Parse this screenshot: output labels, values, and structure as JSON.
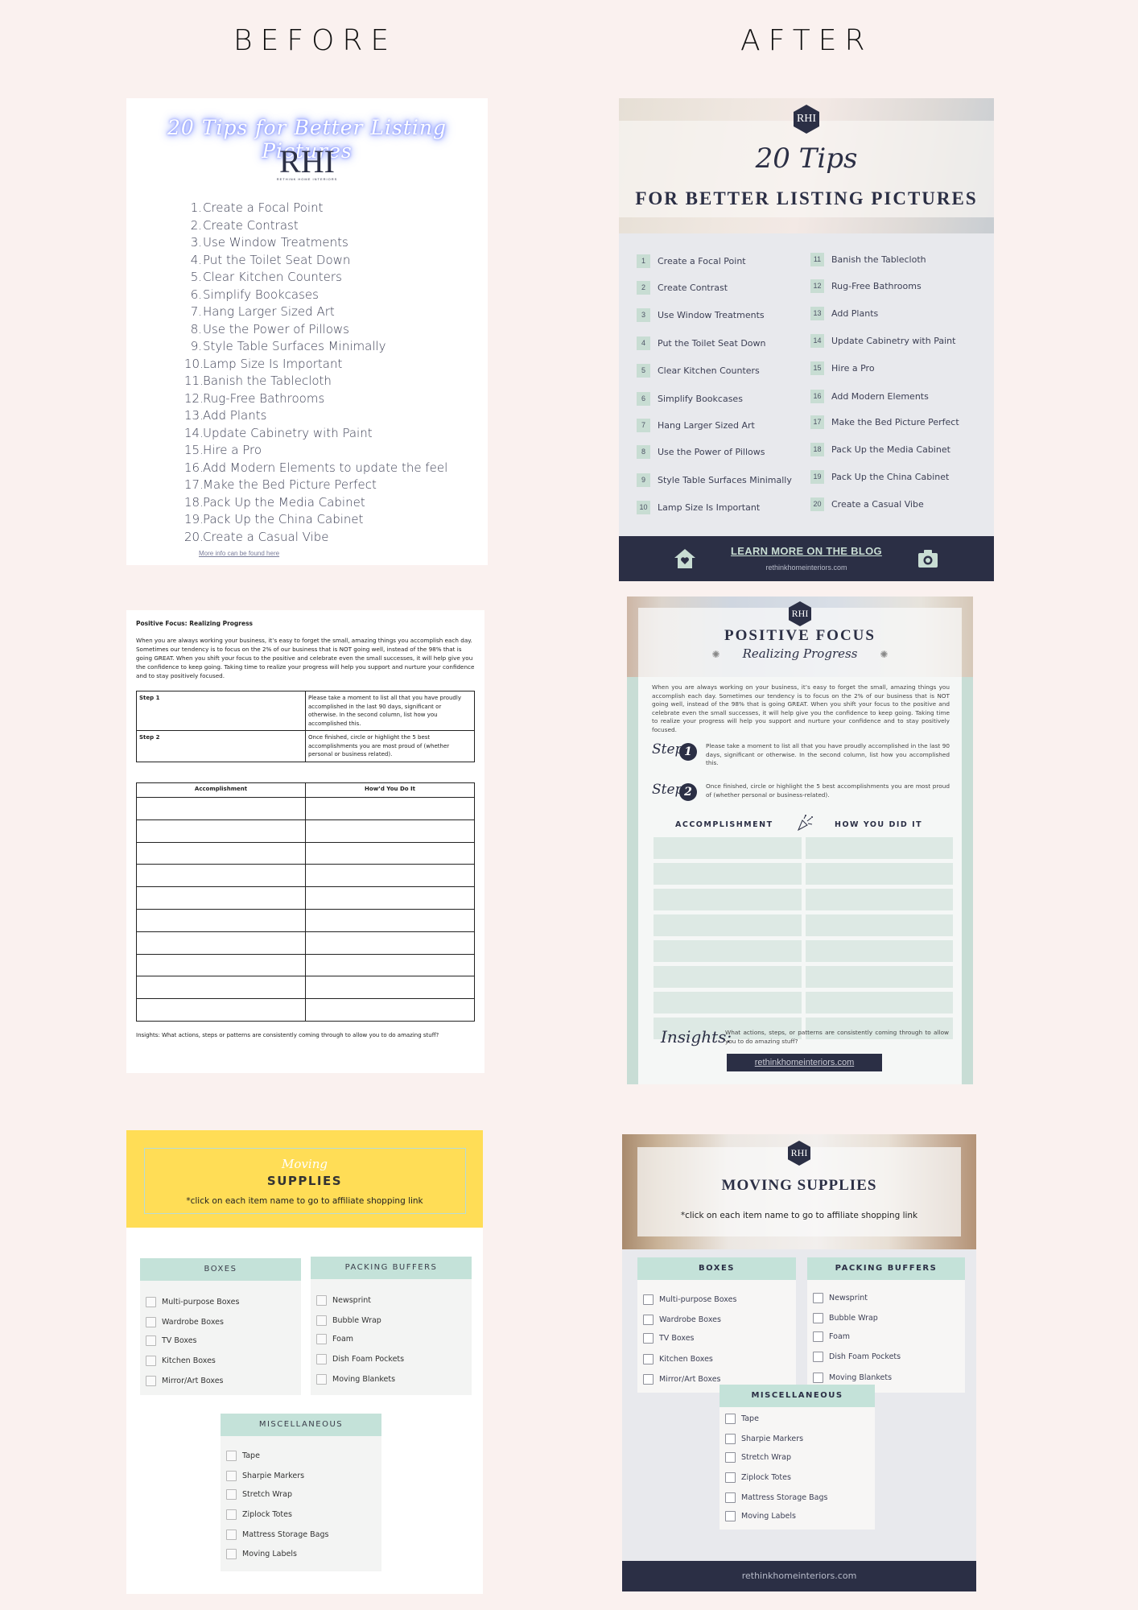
{
  "headers": {
    "before": "BEFORE",
    "after": "AFTER"
  },
  "colors": {
    "page_bg": "#faf1ef",
    "navy": "#2b2f45",
    "mint": "#c4e2d9",
    "yellow": "#ffdd56",
    "neon_blue": "#6a7cff"
  },
  "before_tips": {
    "title": "20 Tips for Better Listing Pictures",
    "logo": "RHI",
    "logo_tagline": "RETHINK HOME INTERIORS",
    "items": [
      "Create a Focal Point",
      "Create Contrast",
      "Use Window Treatments",
      "Put the Toilet Seat Down",
      "Clear Kitchen Counters",
      "Simplify Bookcases",
      "Hang Larger Sized Art",
      "Use the Power of Pillows",
      "Style Table Surfaces Minimally",
      "Lamp Size Is Important",
      "Banish the Tablecloth",
      "Rug-Free Bathrooms",
      "Add Plants",
      "Update Cabinetry with Paint",
      "Hire a Pro",
      "Add Modern Elements to update the feel",
      "Make the Bed Picture Perfect",
      "Pack Up the Media Cabinet",
      "Pack Up the China Cabinet",
      "Create a Casual Vibe"
    ],
    "more_link": "More info can be found here"
  },
  "after_tips": {
    "logo": "RHI",
    "script_title": "20 Tips",
    "title": "FOR BETTER LISTING PICTURES",
    "items": [
      "Create a Focal Point",
      "Create Contrast",
      "Use Window Treatments",
      "Put the Toilet Seat Down",
      "Clear Kitchen Counters",
      "Simplify Bookcases",
      "Hang Larger Sized Art",
      "Use the Power of Pillows",
      "Style Table Surfaces Minimally",
      "Lamp Size Is Important",
      "Banish the Tablecloth",
      "Rug-Free Bathrooms",
      "Add Plants",
      "Update Cabinetry with Paint",
      "Hire a Pro",
      "Add Modern Elements",
      "Make the Bed Picture Perfect",
      "Pack Up the Media Cabinet",
      "Pack Up the China Cabinet",
      "Create a Casual Vibe"
    ],
    "footer_link": "LEARN MORE ON THE BLOG",
    "footer_site": "rethinkhomeinteriors.com",
    "footer_icons": [
      "house-heart-icon",
      "camera-icon"
    ]
  },
  "before_focus": {
    "title": "Positive Focus:  Realizing Progress",
    "intro": "When you are always working your business, it’s easy to forget the small, amazing things you accomplish each day. Sometimes our tendency is to focus on the 2% of our business that is NOT going well, instead of the 98% that is going GREAT. When you shift your focus to the positive and celebrate even the small successes, it will help give you the confidence to keep going. Taking time to realize your progress will help you support and nurture your confidence and to stay positively focused.",
    "steps": [
      {
        "label": "Step 1",
        "text": "Please take a moment to list all that you have proudly accomplished in the last 90 days, significant or otherwise. In the second column, list how you accomplished this."
      },
      {
        "label": "Step 2",
        "text": "Once finished, circle or highlight the 5 best accomplishments you are most proud of (whether personal or business related)."
      }
    ],
    "table_headers": [
      "Accomplishment",
      "How’d You Do It"
    ],
    "table_rows": 10,
    "insights": "Insights: What actions, steps or patterns are consistently coming through to allow you to do amazing stuff?"
  },
  "after_focus": {
    "logo": "RHI",
    "title": "POSITIVE FOCUS",
    "subtitle": "Realizing Progress",
    "intro": "When you are always working on your business, it’s easy to forget the small, amazing things you accomplish each day. Sometimes our tendency is to focus on the 2% of our business that is NOT going well, instead of the 98% that is going GREAT. When you shift your focus to the positive and celebrate even the small successes, it will help give you the confidence to keep going. Taking time to realize your progress will help you support and nurture your confidence and to stay positively focused.",
    "steps": [
      {
        "word": "Step",
        "num": "1",
        "text": "Please take a moment to list all that you have proudly accomplished in the last 90 days, significant or otherwise. In the second column, list how you accomplished this."
      },
      {
        "word": "Step",
        "num": "2",
        "text": "Once finished, circle or highlight the 5 best accomplishments you are most proud of (whether personal or business-related)."
      }
    ],
    "col_headers": [
      "ACCOMPLISHMENT",
      "HOW YOU DID IT"
    ],
    "table_rows": 8,
    "insights_word": "Insights:",
    "insights": "What actions, steps, or patterns are consistently coming through to allow you to do amazing stuff?",
    "url": "rethinkhomeinteriors.com"
  },
  "before_moving": {
    "script": "Moving",
    "title": "SUPPLIES",
    "note": "*click on each item name to go to affiliate shopping link",
    "sections": [
      {
        "title": "BOXES",
        "items": [
          "Multi-purpose Boxes",
          "Wardrobe Boxes",
          "TV Boxes",
          "Kitchen Boxes",
          "Mirror/Art Boxes"
        ]
      },
      {
        "title": "PACKING BUFFERS",
        "items": [
          "Newsprint",
          "Bubble Wrap",
          "Foam",
          "Dish Foam Pockets",
          "Moving Blankets"
        ]
      },
      {
        "title": "MISCELLANEOUS",
        "items": [
          "Tape",
          "Sharpie Markers",
          "Stretch Wrap",
          "Ziplock Totes",
          "Mattress Storage Bags",
          "Moving Labels"
        ]
      }
    ]
  },
  "after_moving": {
    "logo": "RHI",
    "title": "MOVING SUPPLIES",
    "note": "*click on each item name to go to affiliate shopping link",
    "sections": [
      {
        "title": "BOXES",
        "items": [
          "Multi-purpose Boxes",
          "Wardrobe Boxes",
          "TV Boxes",
          "Kitchen Boxes",
          "Mirror/Art Boxes"
        ]
      },
      {
        "title": "PACKING BUFFERS",
        "items": [
          "Newsprint",
          "Bubble Wrap",
          "Foam",
          "Dish Foam Pockets",
          "Moving Blankets"
        ]
      },
      {
        "title": "MISCELLANEOUS",
        "items": [
          "Tape",
          "Sharpie Markers",
          "Stretch Wrap",
          "Ziplock Totes",
          "Mattress Storage Bags",
          "Moving Labels"
        ]
      }
    ],
    "footer_site": "rethinkhomeinteriors.com"
  }
}
